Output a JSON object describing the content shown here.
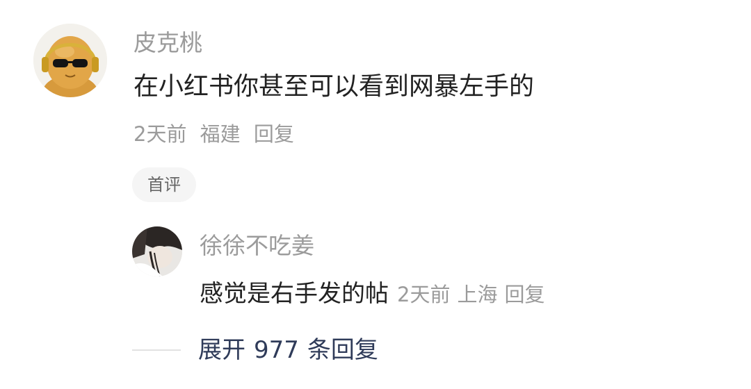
{
  "comment": {
    "username": "皮克桃",
    "content": "在小红书你甚至可以看到网暴左手的",
    "time": "2天前",
    "location": "福建",
    "reply_label": "回复",
    "badge": "首评"
  },
  "reply": {
    "username": "徐徐不吃姜",
    "content": "感觉是右手发的帖",
    "time": "2天前",
    "location": "上海",
    "reply_label": "回复"
  },
  "expand": {
    "prefix": "展开",
    "count": "977",
    "suffix": "条回复"
  }
}
